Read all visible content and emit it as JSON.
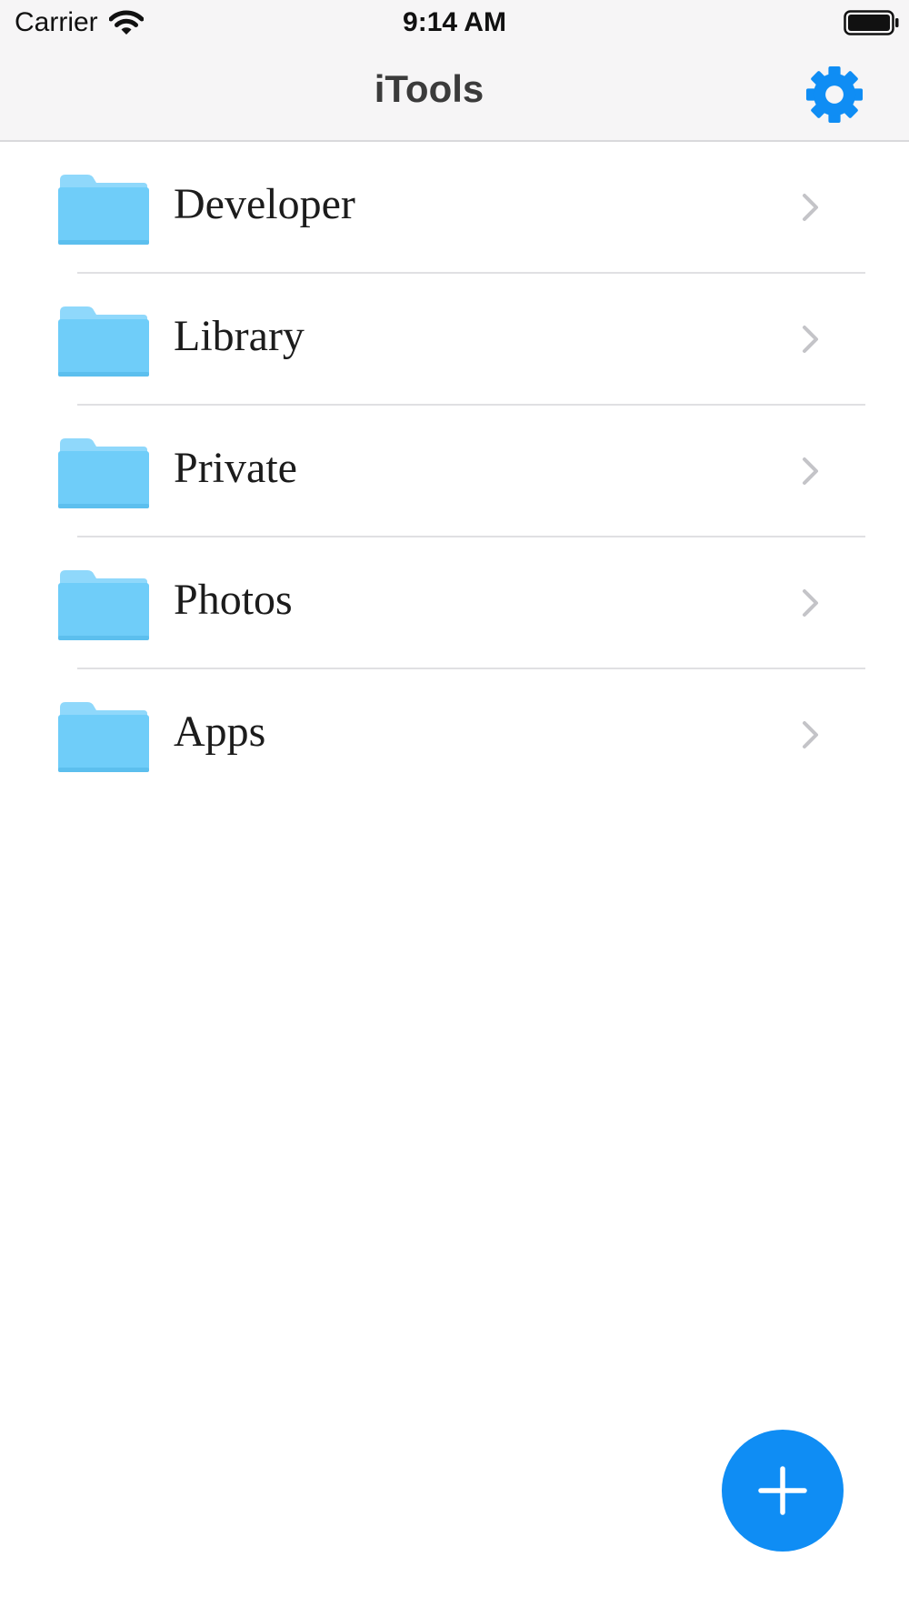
{
  "status_bar": {
    "carrier": "Carrier",
    "time": "9:14 AM",
    "wifi_icon": "wifi-icon",
    "battery_icon": "battery-icon"
  },
  "nav_bar": {
    "title": "iTools",
    "settings_icon": "gear-icon"
  },
  "folders": [
    {
      "label": "Developer",
      "icon": "folder-icon"
    },
    {
      "label": "Library",
      "icon": "folder-icon"
    },
    {
      "label": "Private",
      "icon": "folder-icon"
    },
    {
      "label": "Photos",
      "icon": "folder-icon"
    },
    {
      "label": "Apps",
      "icon": "folder-icon"
    }
  ],
  "fab": {
    "icon": "plus-icon"
  },
  "colors": {
    "accent": "#0f8df4",
    "folder": "#6fcdf9",
    "bar_background": "#f6f5f6"
  }
}
